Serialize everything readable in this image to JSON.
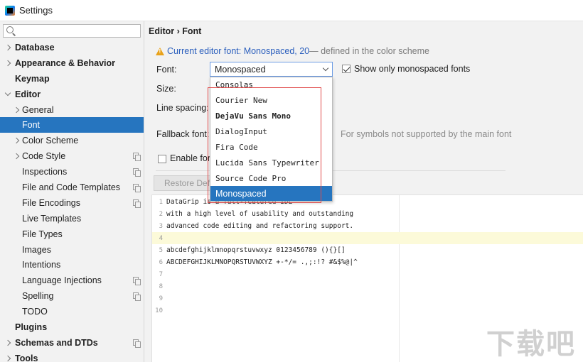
{
  "window": {
    "title": "Settings"
  },
  "search": {
    "placeholder": "",
    "value": ""
  },
  "sidebar": {
    "items": [
      {
        "label": "Database",
        "level": 0,
        "arrow": "right",
        "bold": true,
        "copy": false,
        "selected": false
      },
      {
        "label": "Appearance & Behavior",
        "level": 0,
        "arrow": "right",
        "bold": true,
        "copy": false,
        "selected": false
      },
      {
        "label": "Keymap",
        "level": 0,
        "arrow": "",
        "bold": true,
        "copy": false,
        "selected": false
      },
      {
        "label": "Editor",
        "level": 0,
        "arrow": "down",
        "bold": true,
        "copy": false,
        "selected": false
      },
      {
        "label": "General",
        "level": 1,
        "arrow": "right",
        "bold": false,
        "copy": false,
        "selected": false
      },
      {
        "label": "Font",
        "level": 1,
        "arrow": "",
        "bold": false,
        "copy": false,
        "selected": true
      },
      {
        "label": "Color Scheme",
        "level": 1,
        "arrow": "right",
        "bold": false,
        "copy": false,
        "selected": false
      },
      {
        "label": "Code Style",
        "level": 1,
        "arrow": "right",
        "bold": false,
        "copy": true,
        "selected": false
      },
      {
        "label": "Inspections",
        "level": 1,
        "arrow": "",
        "bold": false,
        "copy": true,
        "selected": false
      },
      {
        "label": "File and Code Templates",
        "level": 1,
        "arrow": "",
        "bold": false,
        "copy": true,
        "selected": false
      },
      {
        "label": "File Encodings",
        "level": 1,
        "arrow": "",
        "bold": false,
        "copy": true,
        "selected": false
      },
      {
        "label": "Live Templates",
        "level": 1,
        "arrow": "",
        "bold": false,
        "copy": false,
        "selected": false
      },
      {
        "label": "File Types",
        "level": 1,
        "arrow": "",
        "bold": false,
        "copy": false,
        "selected": false
      },
      {
        "label": "Images",
        "level": 1,
        "arrow": "",
        "bold": false,
        "copy": false,
        "selected": false
      },
      {
        "label": "Intentions",
        "level": 1,
        "arrow": "",
        "bold": false,
        "copy": false,
        "selected": false
      },
      {
        "label": "Language Injections",
        "level": 1,
        "arrow": "",
        "bold": false,
        "copy": true,
        "selected": false
      },
      {
        "label": "Spelling",
        "level": 1,
        "arrow": "",
        "bold": false,
        "copy": true,
        "selected": false
      },
      {
        "label": "TODO",
        "level": 1,
        "arrow": "",
        "bold": false,
        "copy": false,
        "selected": false
      },
      {
        "label": "Plugins",
        "level": 0,
        "arrow": "",
        "bold": true,
        "copy": false,
        "selected": false
      },
      {
        "label": "Schemas and DTDs",
        "level": 0,
        "arrow": "right",
        "bold": true,
        "copy": true,
        "selected": false
      },
      {
        "label": "Tools",
        "level": 0,
        "arrow": "right",
        "bold": true,
        "copy": false,
        "selected": false
      }
    ]
  },
  "main": {
    "breadcrumb": "Editor › Font",
    "notice": {
      "link": "Current editor font: Monospaced, 20",
      "rest": " — defined in the color scheme"
    },
    "labels": {
      "font": "Font:",
      "size": "Size:",
      "line_spacing": "Line spacing:",
      "fallback": "Fallback font:",
      "enable": "Enable font"
    },
    "font_value": "Monospaced",
    "show_mono_label": "Show only monospaced fonts",
    "show_mono_checked": true,
    "fallback_hint": "For symbols not supported by the main font",
    "restore_label": "Restore Defaults"
  },
  "dropdown": {
    "options": [
      {
        "label": "Consolas",
        "style": "mono"
      },
      {
        "label": "Courier New",
        "style": "mono"
      },
      {
        "label": "DejaVu Sans Mono",
        "style": "bold"
      },
      {
        "label": "DialogInput",
        "style": "mono"
      },
      {
        "label": "Fira Code",
        "style": "mono"
      },
      {
        "label": "Lucida Sans Typewriter",
        "style": "mono"
      },
      {
        "label": "Source Code Pro",
        "style": "mono"
      },
      {
        "label": "Monospaced",
        "style": "selected"
      }
    ]
  },
  "preview": {
    "lines": [
      {
        "num": "1",
        "code": "DataGrip is a full-featured IDE"
      },
      {
        "num": "2",
        "code": "with a high level of usability and outstanding"
      },
      {
        "num": "3",
        "code": "advanced code editing and refactoring support."
      },
      {
        "num": "4",
        "code": ""
      },
      {
        "num": "5",
        "code": "abcdefghijklmnopqrstuvwxyz 0123456789 (){}[]"
      },
      {
        "num": "6",
        "code": "ABCDEFGHIJKLMNOPQRSTUVWXYZ +-*/= .,;:!? #&$%@|^"
      },
      {
        "num": "7",
        "code": ""
      },
      {
        "num": "8",
        "code": ""
      },
      {
        "num": "9",
        "code": ""
      },
      {
        "num": "10",
        "code": ""
      }
    ],
    "current_line": 4
  },
  "watermark": {
    "text": "下载吧"
  }
}
